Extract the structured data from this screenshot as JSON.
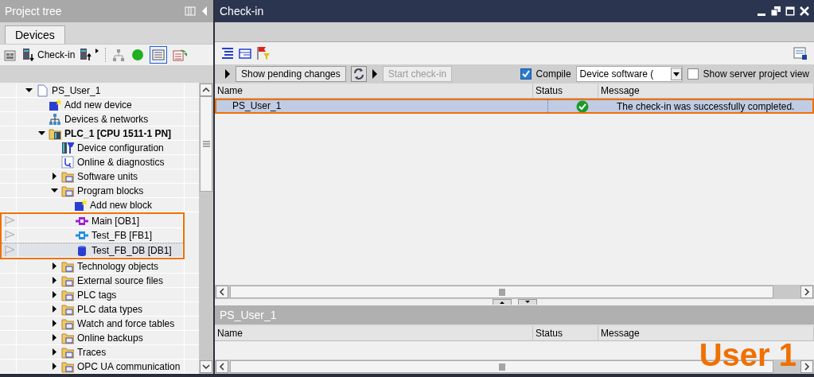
{
  "project_tree": {
    "title": "Project tree",
    "tabs": [
      {
        "label": "Devices",
        "selected": true
      }
    ],
    "toolbar": {
      "checkin_label": "Check-in"
    },
    "items": [
      {
        "label": "PS_User_1",
        "kind": "project",
        "expanded": true,
        "selected": false,
        "children": [
          {
            "label": "Add new device",
            "kind": "add",
            "selected": false
          },
          {
            "label": "Devices & networks",
            "kind": "network",
            "selected": false
          },
          {
            "label": "PLC_1 [CPU 1511-1 PN]",
            "kind": "plc",
            "expanded": true,
            "selected": false,
            "children": [
              {
                "label": "Device configuration",
                "kind": "config",
                "selected": false
              },
              {
                "label": "Online & diagnostics",
                "kind": "diagnostics",
                "selected": false
              },
              {
                "label": "Software units",
                "kind": "folder",
                "expanded": false,
                "selected": false
              },
              {
                "label": "Program blocks",
                "kind": "folder",
                "expanded": true,
                "selected": false,
                "children": [
                  {
                    "label": "Add new block",
                    "kind": "add",
                    "selected": false
                  },
                  {
                    "label": "Main [OB1]",
                    "kind": "block-ob",
                    "flagged": true,
                    "highlighted": true,
                    "selected": false
                  },
                  {
                    "label": "Test_FB [FB1]",
                    "kind": "block-fb",
                    "flagged": true,
                    "highlighted": true,
                    "selected": false
                  },
                  {
                    "label": "Test_FB_DB [DB1]",
                    "kind": "block-db",
                    "flagged": true,
                    "highlighted": true,
                    "selected": true
                  }
                ]
              },
              {
                "label": "Technology objects",
                "kind": "folder",
                "expanded": false,
                "selected": false
              },
              {
                "label": "External source files",
                "kind": "folder",
                "expanded": false,
                "selected": false
              },
              {
                "label": "PLC tags",
                "kind": "folder",
                "expanded": false,
                "selected": false
              },
              {
                "label": "PLC data types",
                "kind": "folder",
                "expanded": false,
                "selected": false
              },
              {
                "label": "Watch and force tables",
                "kind": "folder",
                "expanded": false,
                "selected": false
              },
              {
                "label": "Online backups",
                "kind": "folder",
                "expanded": false,
                "selected": false
              },
              {
                "label": "Traces",
                "kind": "folder",
                "expanded": false,
                "selected": false
              },
              {
                "label": "OPC UA communication",
                "kind": "folder",
                "expanded": false,
                "selected": false
              }
            ]
          }
        ]
      }
    ]
  },
  "checkin": {
    "title": "Check-in",
    "actions": {
      "show_pending": "Show pending changes",
      "start": {
        "label": "Start check-in",
        "disabled": true
      },
      "compile": {
        "label": "Compile",
        "checked": true
      },
      "dropdown": {
        "value": "Device software ("
      },
      "server_view": {
        "label": "Show server project view",
        "checked": false
      }
    },
    "table": {
      "columns": [
        "Name",
        "Status",
        "Message"
      ],
      "rows": [
        {
          "name": "PS_User_1",
          "success": true,
          "message": "The check-in was successfully completed.",
          "selected": true,
          "highlighted": true
        }
      ]
    },
    "details": {
      "title": "PS_User_1",
      "columns": [
        "Name",
        "Status",
        "Message"
      ]
    }
  },
  "annotation": "User 1"
}
